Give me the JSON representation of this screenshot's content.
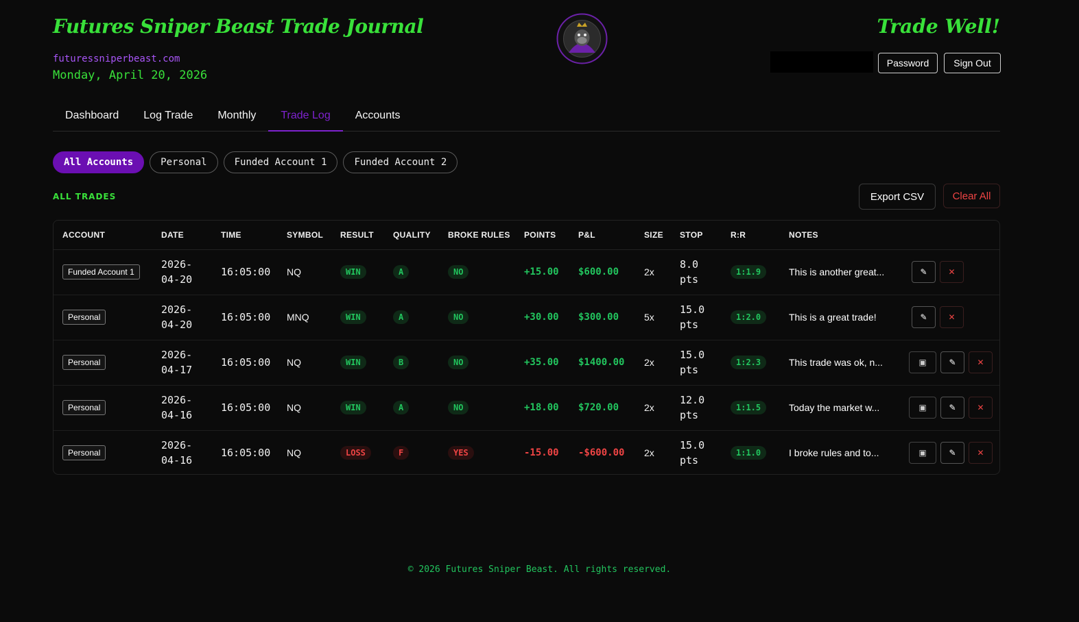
{
  "header": {
    "title": "Futures Sniper Beast Trade Journal",
    "site": "futuressniperbeast.com",
    "date": "Monday, April 20, 2026",
    "tagline": "Trade Well!",
    "logo_icon": "gorilla-logo-icon",
    "password_label": "Password",
    "signout_label": "Sign Out"
  },
  "tabs": [
    {
      "label": "Dashboard",
      "active": false
    },
    {
      "label": "Log Trade",
      "active": false
    },
    {
      "label": "Monthly",
      "active": false
    },
    {
      "label": "Trade Log",
      "active": true
    },
    {
      "label": "Accounts",
      "active": false
    }
  ],
  "filters": [
    {
      "label": "All Accounts",
      "active": true
    },
    {
      "label": "Personal",
      "active": false
    },
    {
      "label": "Funded Account 1",
      "active": false
    },
    {
      "label": "Funded Account 2",
      "active": false
    }
  ],
  "section_label": "ALL TRADES",
  "actions": {
    "export_label": "Export CSV",
    "clear_label": "Clear All"
  },
  "table": {
    "columns": [
      "ACCOUNT",
      "DATE",
      "TIME",
      "SYMBOL",
      "RESULT",
      "QUALITY",
      "BROKE RULES",
      "POINTS",
      "P&L",
      "SIZE",
      "STOP",
      "R:R",
      "NOTES"
    ],
    "rows": [
      {
        "account": "Funded Account 1",
        "date1": "2026-",
        "date2": "04-20",
        "time": "16:05:00",
        "symbol": "NQ",
        "result": "WIN",
        "quality": "A",
        "broke": "NO",
        "points": "+15.00",
        "pnl": "$600.00",
        "size": "2x",
        "stop1": "8.0",
        "stop2": "pts",
        "rr": "1:1.9",
        "notes": "This is another great...",
        "has_photo": false,
        "positive": true
      },
      {
        "account": "Personal",
        "date1": "2026-",
        "date2": "04-20",
        "time": "16:05:00",
        "symbol": "MNQ",
        "result": "WIN",
        "quality": "A",
        "broke": "NO",
        "points": "+30.00",
        "pnl": "$300.00",
        "size": "5x",
        "stop1": "15.0",
        "stop2": "pts",
        "rr": "1:2.0",
        "notes": "This is a great trade!",
        "has_photo": false,
        "positive": true
      },
      {
        "account": "Personal",
        "date1": "2026-",
        "date2": "04-17",
        "time": "16:05:00",
        "symbol": "NQ",
        "result": "WIN",
        "quality": "B",
        "broke": "NO",
        "points": "+35.00",
        "pnl": "$1400.00",
        "size": "2x",
        "stop1": "15.0",
        "stop2": "pts",
        "rr": "1:2.3",
        "notes": "This trade was ok, n...",
        "has_photo": true,
        "positive": true
      },
      {
        "account": "Personal",
        "date1": "2026-",
        "date2": "04-16",
        "time": "16:05:00",
        "symbol": "NQ",
        "result": "WIN",
        "quality": "A",
        "broke": "NO",
        "points": "+18.00",
        "pnl": "$720.00",
        "size": "2x",
        "stop1": "12.0",
        "stop2": "pts",
        "rr": "1:1.5",
        "notes": "Today the market w...",
        "has_photo": true,
        "positive": true
      },
      {
        "account": "Personal",
        "date1": "2026-",
        "date2": "04-16",
        "time": "16:05:00",
        "symbol": "NQ",
        "result": "LOSS",
        "quality": "F",
        "broke": "YES",
        "points": "-15.00",
        "pnl": "-$600.00",
        "size": "2x",
        "stop1": "15.0",
        "stop2": "pts",
        "rr": "1:1.0",
        "notes": "I broke rules and to...",
        "has_photo": true,
        "positive": false
      }
    ]
  },
  "footer": "© 2026 Futures Sniper Beast. All rights reserved.",
  "colors": {
    "accent_green": "#39e13a",
    "accent_purple": "#7e22ce",
    "danger": "#ef4444"
  }
}
